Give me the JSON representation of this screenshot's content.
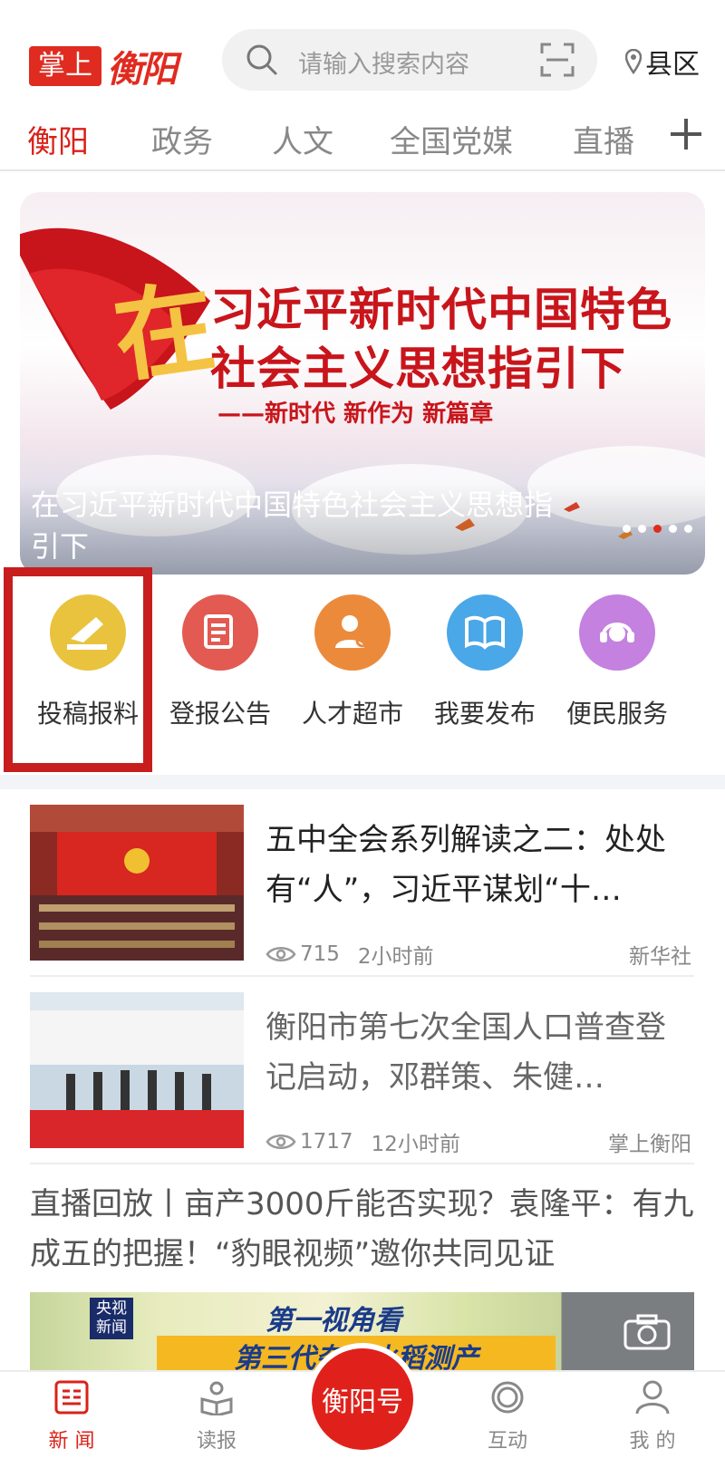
{
  "header": {
    "logo_box": "掌上",
    "logo_script": "衡阳",
    "search_placeholder": "请输入搜索内容",
    "region": "县区"
  },
  "tabs": [
    "衡阳",
    "政务",
    "人文",
    "全国党媒",
    "直播"
  ],
  "active_tab": 0,
  "banner": {
    "art_char": "在",
    "art_line1": "习近平新时代中国特色",
    "art_line2": "社会主义思想指引下",
    "art_line3": "——新时代 新作为 新篇章",
    "caption": "在习近平新时代中国特色社会主义思想指引下",
    "slide_count": 5,
    "active_slide": 3
  },
  "quick_nav": [
    {
      "label": "投稿报料",
      "color": "#e9c33e",
      "icon": "contribute-icon"
    },
    {
      "label": "登报公告",
      "color": "#e25a52",
      "icon": "newspaper-icon"
    },
    {
      "label": "人才超市",
      "color": "#ec8a3c",
      "icon": "talent-icon"
    },
    {
      "label": "我要发布",
      "color": "#4aa7e8",
      "icon": "publish-icon"
    },
    {
      "label": "便民服务",
      "color": "#c481e0",
      "icon": "customer-service-icon"
    }
  ],
  "news": [
    {
      "title": "五中全会系列解读之二：处处有“人”，习近平谋划“十…",
      "views": "715",
      "time": "2小时前",
      "source": "新华社"
    },
    {
      "title": "衡阳市第七次全国人口普查登记启动，邓群策、朱健…",
      "views": "1717",
      "time": "12小时前",
      "source": "掌上衡阳"
    }
  ],
  "video_news": {
    "title": "直播回放丨亩产3000斤能否实现？袁隆平：有九成五的把握！“豹眼视频”邀你共同见证",
    "logo": "央视新闻",
    "overlay1": "第一视角看",
    "overlay2": "第三代杂交水稻测产"
  },
  "bottom_nav": {
    "items": [
      "新 闻",
      "读报",
      "互动",
      "我 的"
    ],
    "center": "衡阳号"
  }
}
